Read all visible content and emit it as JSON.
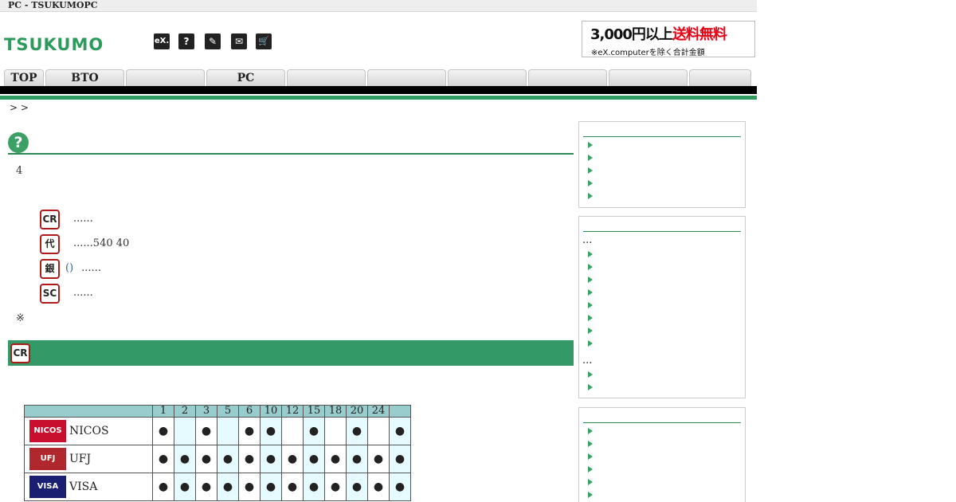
{
  "top_bar": {
    "title": "PC  - TSUKUMOPC"
  },
  "header": {
    "logo": "TSUKUMO",
    "icons": [
      {
        "name": "ex-icon",
        "glyph": "eX."
      },
      {
        "name": "help-icon",
        "glyph": "?"
      },
      {
        "name": "tools-icon",
        "glyph": "✎"
      },
      {
        "name": "mail-icon",
        "glyph": "✉"
      },
      {
        "name": "cart-icon",
        "glyph": "🛒"
      }
    ],
    "banner": {
      "amount": "3,000円以上",
      "free": "送料無料",
      "note": "※eX.computerを除く合計金額"
    }
  },
  "nav": {
    "tabs": [
      "TOP",
      "BTO",
      "",
      "PC",
      "",
      "",
      "",
      "",
      "",
      ""
    ]
  },
  "breadcrumb": ">  >",
  "main": {
    "intro": "4",
    "payments": [
      {
        "badge": "CR",
        "link": "",
        "text": "......"
      },
      {
        "badge": "代",
        "link": "",
        "text": "......540 40"
      },
      {
        "badge": "銀",
        "link": "()",
        "text": "......"
      },
      {
        "badge": "SC",
        "link": "",
        "text": "......"
      }
    ],
    "note": "※",
    "section_badge": "CR"
  },
  "card_table": {
    "headers": [
      "",
      "1",
      "2",
      "3",
      "5",
      "6",
      "10",
      "12",
      "15",
      "18",
      "20",
      "24",
      ""
    ],
    "rows": [
      {
        "name": "NICOS",
        "logo_text": "NICOS",
        "logo_color": "#c8102e",
        "marks": [
          "●",
          "",
          "●",
          "",
          "●",
          "●",
          "",
          "●",
          "",
          "●",
          "",
          "●"
        ]
      },
      {
        "name": "UFJ",
        "logo_text": "UFJ Card",
        "logo_color": "#b0282e",
        "marks": [
          "●",
          "●",
          "●",
          "●",
          "●",
          "●",
          "●",
          "●",
          "●",
          "●",
          "●",
          "●"
        ]
      },
      {
        "name": "VISA",
        "logo_text": "VISA",
        "logo_color": "#1a1f71",
        "marks": [
          "●",
          "●",
          "●",
          "●",
          "●",
          "●",
          "●",
          "●",
          "●",
          "●",
          "●",
          "●"
        ]
      }
    ]
  },
  "sidebar": {
    "box1": {
      "items": [
        "",
        "",
        "",
        "",
        ""
      ]
    },
    "box2": {
      "dots1": "...",
      "items1": [
        "",
        "",
        "",
        "",
        "",
        "",
        "",
        ""
      ],
      "dots2": "...",
      "items2": [
        "",
        ""
      ]
    },
    "box3": {
      "items": [
        "",
        "",
        "",
        "",
        "",
        ""
      ]
    }
  }
}
